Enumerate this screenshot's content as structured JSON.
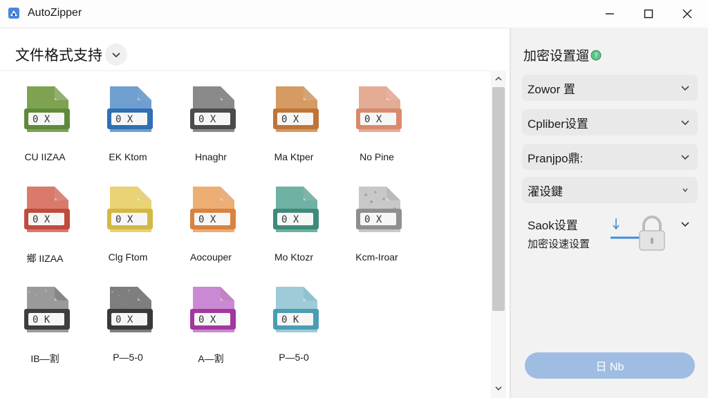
{
  "window": {
    "title": "AutoZipper",
    "minimize_glyph": "—",
    "maximize_glyph": "☐",
    "close_glyph": "✕",
    "icon": "app-zip-icon"
  },
  "left": {
    "section_title": "文件格式支持",
    "dropdown_icon": "chevron-down-icon",
    "files": [
      {
        "label": "CU IIZAA",
        "badge": "0 X",
        "color": "#7ea24f",
        "color2": "#5f8a3a",
        "pattern": "plain"
      },
      {
        "label": "EK Ktom",
        "badge": "0 X",
        "color": "#6e9fcf",
        "color2": "#2f6fb3",
        "pattern": "plain"
      },
      {
        "label": "Hnaghr",
        "badge": "0 X",
        "color": "#8a8a8a",
        "color2": "#4b4b4b",
        "pattern": "plain"
      },
      {
        "label": "Ma Ktper",
        "badge": "0 X",
        "color": "#d69a63",
        "color2": "#c07436",
        "pattern": "plain"
      },
      {
        "label": "No Pine",
        "badge": "0 X",
        "color": "#e4ab95",
        "color2": "#d98a6c",
        "pattern": "plain"
      },
      {
        "label": "鄉 IIZAA",
        "badge": "0 X",
        "color": "#d97a6b",
        "color2": "#c14a3c",
        "pattern": "plain"
      },
      {
        "label": "Clg Ftom",
        "badge": "0 X",
        "color": "#e9d374",
        "color2": "#d4b845",
        "pattern": "plain"
      },
      {
        "label": "Aocouper",
        "badge": "0 X",
        "color": "#ecae73",
        "color2": "#d9833f",
        "pattern": "plain"
      },
      {
        "label": "Mo Ktozr",
        "badge": "0 X",
        "color": "#6fb2a4",
        "color2": "#3f8b7b",
        "pattern": "plain"
      },
      {
        "label": "Kcm-Iroar",
        "badge": "0 X",
        "color": "#c8c8c8",
        "color2": "#8f8f8f",
        "pattern": "dots"
      },
      {
        "label": "IB—割",
        "badge": "0 K",
        "color": "#9a9a9a",
        "color2": "#3e3e3e",
        "pattern": "noise"
      },
      {
        "label": "P—5-0",
        "badge": "0 X",
        "color": "#7e7e7e",
        "color2": "#3a3a3a",
        "pattern": "noise"
      },
      {
        "label": "A—割",
        "badge": "0 X",
        "color": "#c98ad3",
        "color2": "#a2389e",
        "pattern": "plain"
      },
      {
        "label": "P—5-0",
        "badge": "0 K",
        "color": "#9fcbd8",
        "color2": "#4a9db3",
        "pattern": "plain"
      }
    ],
    "scroll_up_icon": "chevron-up-icon",
    "scroll_down_icon": "chevron-down-icon"
  },
  "right": {
    "title": "加密设置遛",
    "title_icon": "info-icon",
    "rows": [
      {
        "label": "Zowor 置"
      },
      {
        "label": "Cpliber设置"
      },
      {
        "label": "Pranjpo鼎:"
      },
      {
        "label": "濯设鍵"
      }
    ],
    "lock": {
      "title": "Saok设置",
      "subtitle": "加密设速设置"
    },
    "primary_button": "日 Nb"
  }
}
